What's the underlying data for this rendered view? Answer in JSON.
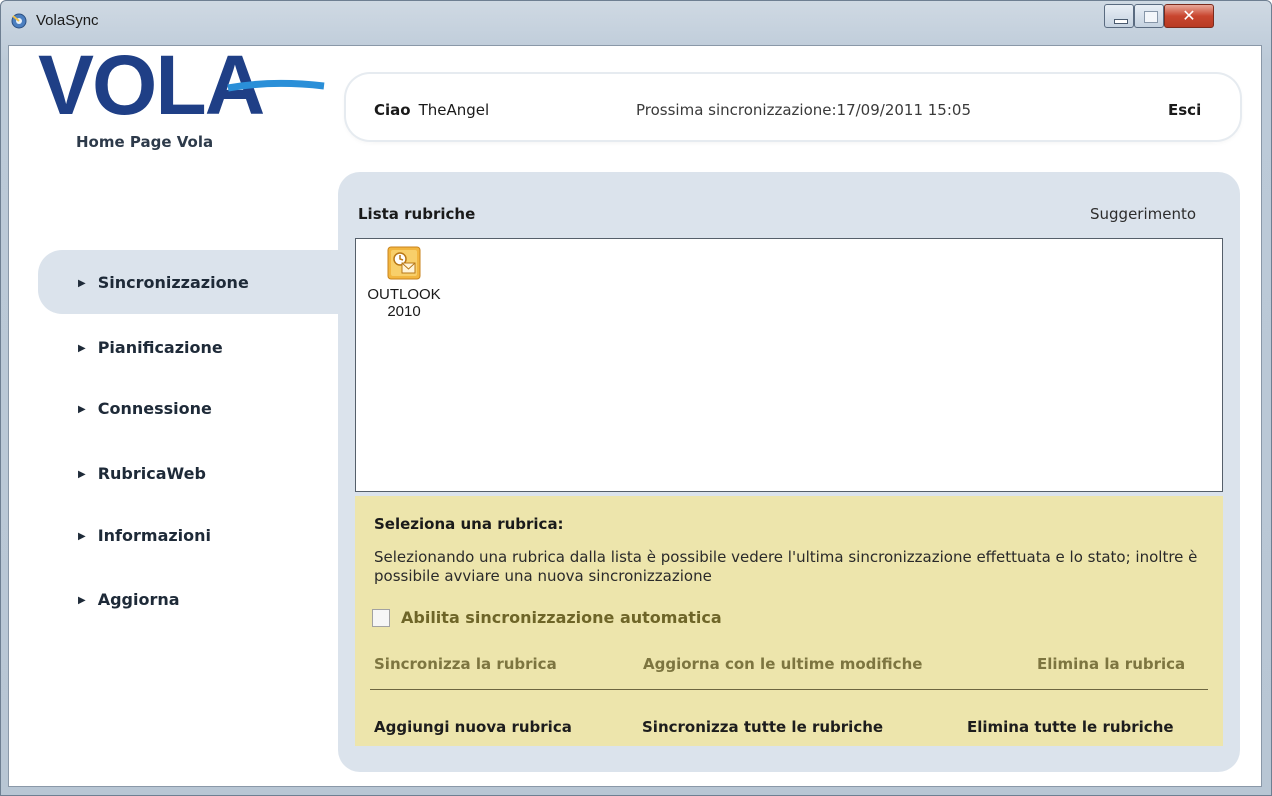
{
  "window": {
    "title": "VolaSync"
  },
  "brand": {
    "logo_text": "VOLA",
    "home_link": "Home Page Vola"
  },
  "header": {
    "greeting": "Ciao",
    "username": "TheAngel",
    "next_sync": "Prossima sincronizzazione:17/09/2011 15:05",
    "logout": "Esci"
  },
  "sidebar": {
    "items": [
      {
        "label": "Sincronizzazione",
        "active": true
      },
      {
        "label": "Pianificazione"
      },
      {
        "label": "Connessione"
      },
      {
        "label": "RubricaWeb"
      },
      {
        "label": "Informazioni"
      },
      {
        "label": "Aggiorna"
      }
    ]
  },
  "main": {
    "list_title": "Lista rubriche",
    "hint": "Suggerimento",
    "address_books": [
      {
        "name_line1": "OUTLOOK",
        "name_line2": "2010",
        "icon": "outlook-icon"
      }
    ],
    "info": {
      "title": "Seleziona una rubrica:",
      "text": "Selezionando una rubrica dalla lista è possibile vedere l'ultima sincronizzazione effettuata e lo stato; inoltre è possibile avviare una nuova sincronizzazione",
      "auto_sync_label": "Abilita sincronizzazione automatica",
      "auto_sync_checked": false
    },
    "actions": {
      "sync_book": "Sincronizza la rubrica",
      "update_changes": "Aggiorna con le ultime modifiche",
      "delete_book": "Elimina la rubrica",
      "add_book": "Aggiungi nuova rubrica",
      "sync_all": "Sincronizza tutte le rubriche",
      "delete_all": "Elimina tutte le rubriche"
    }
  },
  "colors": {
    "logo_blue": "#1f3f86",
    "panel_bg": "#dbe3ec",
    "info_bg": "#ede5ac",
    "action_disabled": "#7d7540"
  }
}
